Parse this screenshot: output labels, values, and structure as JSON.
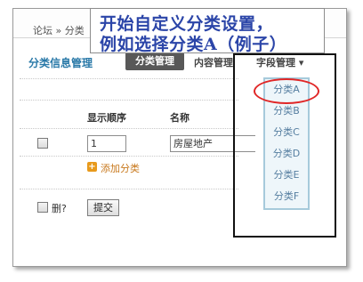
{
  "breadcrumb": "论坛 » 分类",
  "callout": {
    "line1": "开始自定义分类设置，",
    "line2": "例如选择分类A（例子）"
  },
  "section_title": "分类信息管理",
  "tabs": {
    "category": "分类管理",
    "content": "内容管理",
    "field": "字段管理",
    "field_arrow": "▾"
  },
  "columns": {
    "order": "显示顺序",
    "name": "名称"
  },
  "row": {
    "order": "1",
    "name": "房屋地产"
  },
  "add_category": "添加分类",
  "add_icon": "+",
  "delete_label": "删?",
  "submit": "提交",
  "dropdown": {
    "items": [
      "分类A",
      "分类B",
      "分类C",
      "分类D",
      "分类E",
      "分类F"
    ]
  }
}
